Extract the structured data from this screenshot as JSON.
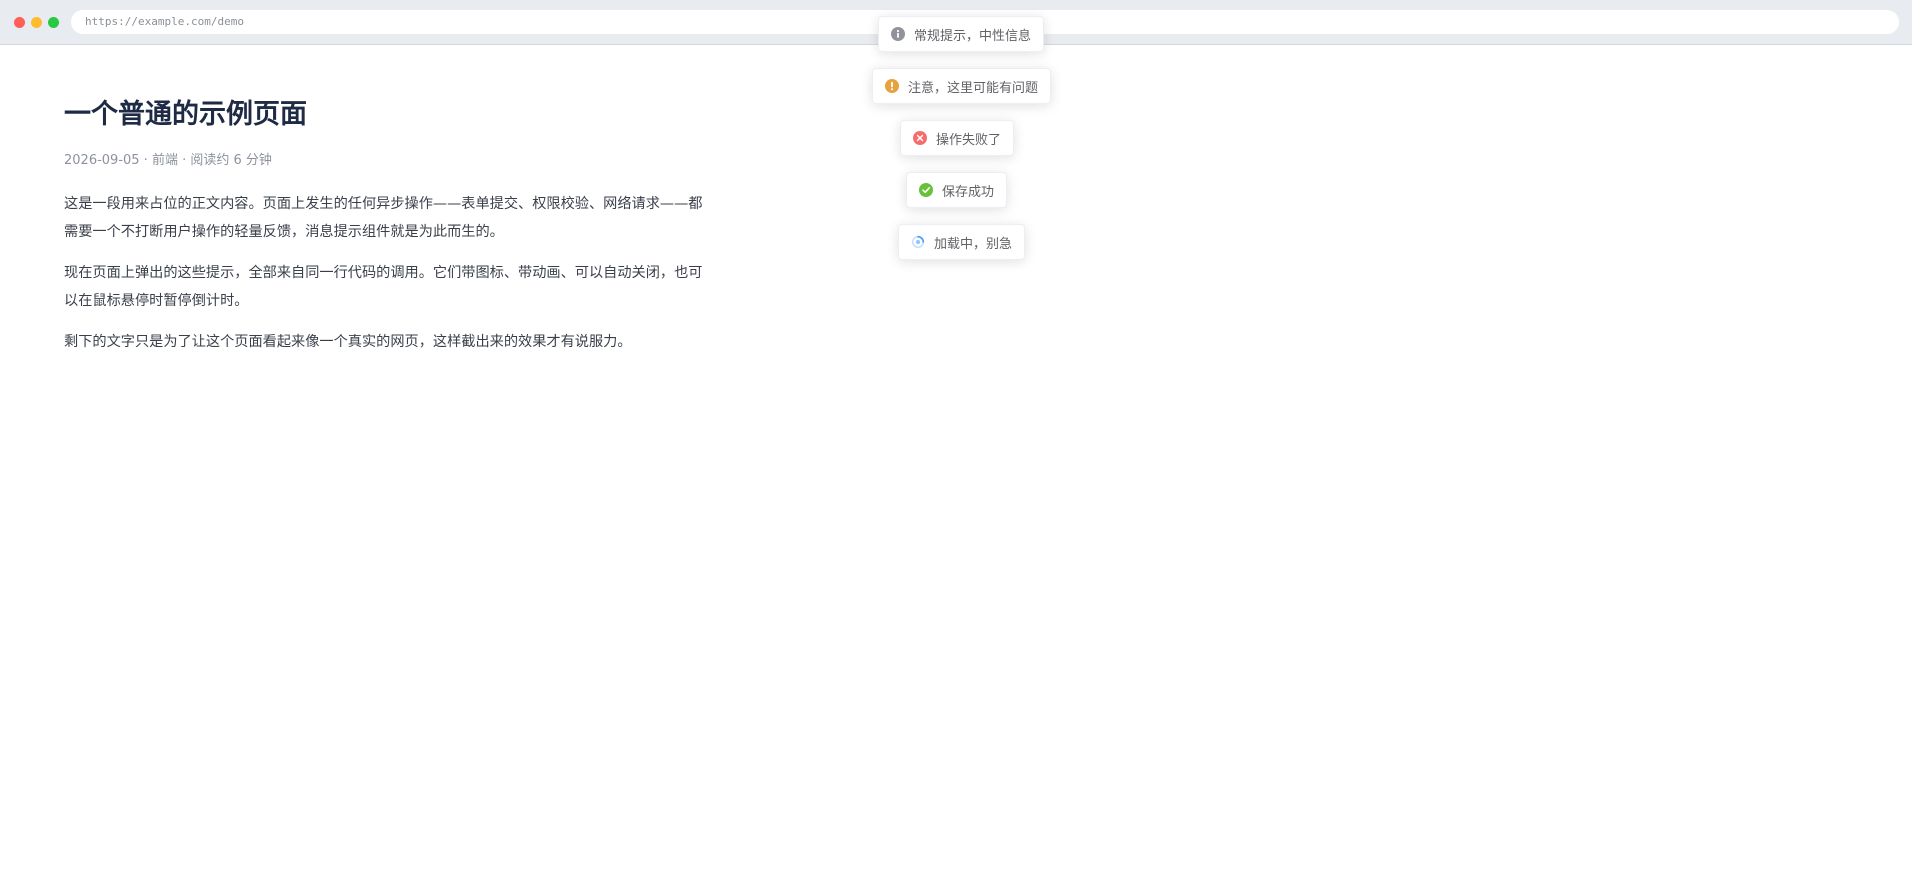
{
  "browser": {
    "url": "https://example.com/demo"
  },
  "article": {
    "title": "一个普通的示例页面",
    "meta": "2026-09-05 · 前端 · 阅读约 6 分钟",
    "paragraphs": [
      "这是一段用来占位的正文内容。页面上发生的任何异步操作——表单提交、权限校验、网络请求——都需要一个不打断用户操作的轻量反馈，消息提示组件就是为此而生的。",
      "现在页面上弹出的这些提示，全部来自同一行代码的调用。它们带图标、带动画、可以自动关闭，也可以在鼠标悬停时暂停倒计时。",
      "剩下的文字只是为了让这个页面看起来像一个真实的网页，这样截出来的效果才有说服力。"
    ]
  },
  "toasts": [
    {
      "type": "info",
      "icon": "info-icon",
      "text": "常规提示，中性信息",
      "color": "#909399"
    },
    {
      "type": "warning",
      "icon": "warning-icon",
      "text": "注意，这里可能有问题",
      "color": "#e6a23c"
    },
    {
      "type": "error",
      "icon": "error-icon",
      "text": "操作失败了",
      "color": "#f56c6c"
    },
    {
      "type": "success",
      "icon": "success-icon",
      "text": "保存成功",
      "color": "#67c23a"
    },
    {
      "type": "loading",
      "icon": "loading-icon",
      "text": "加载中，别急",
      "color": "#409eff"
    }
  ]
}
